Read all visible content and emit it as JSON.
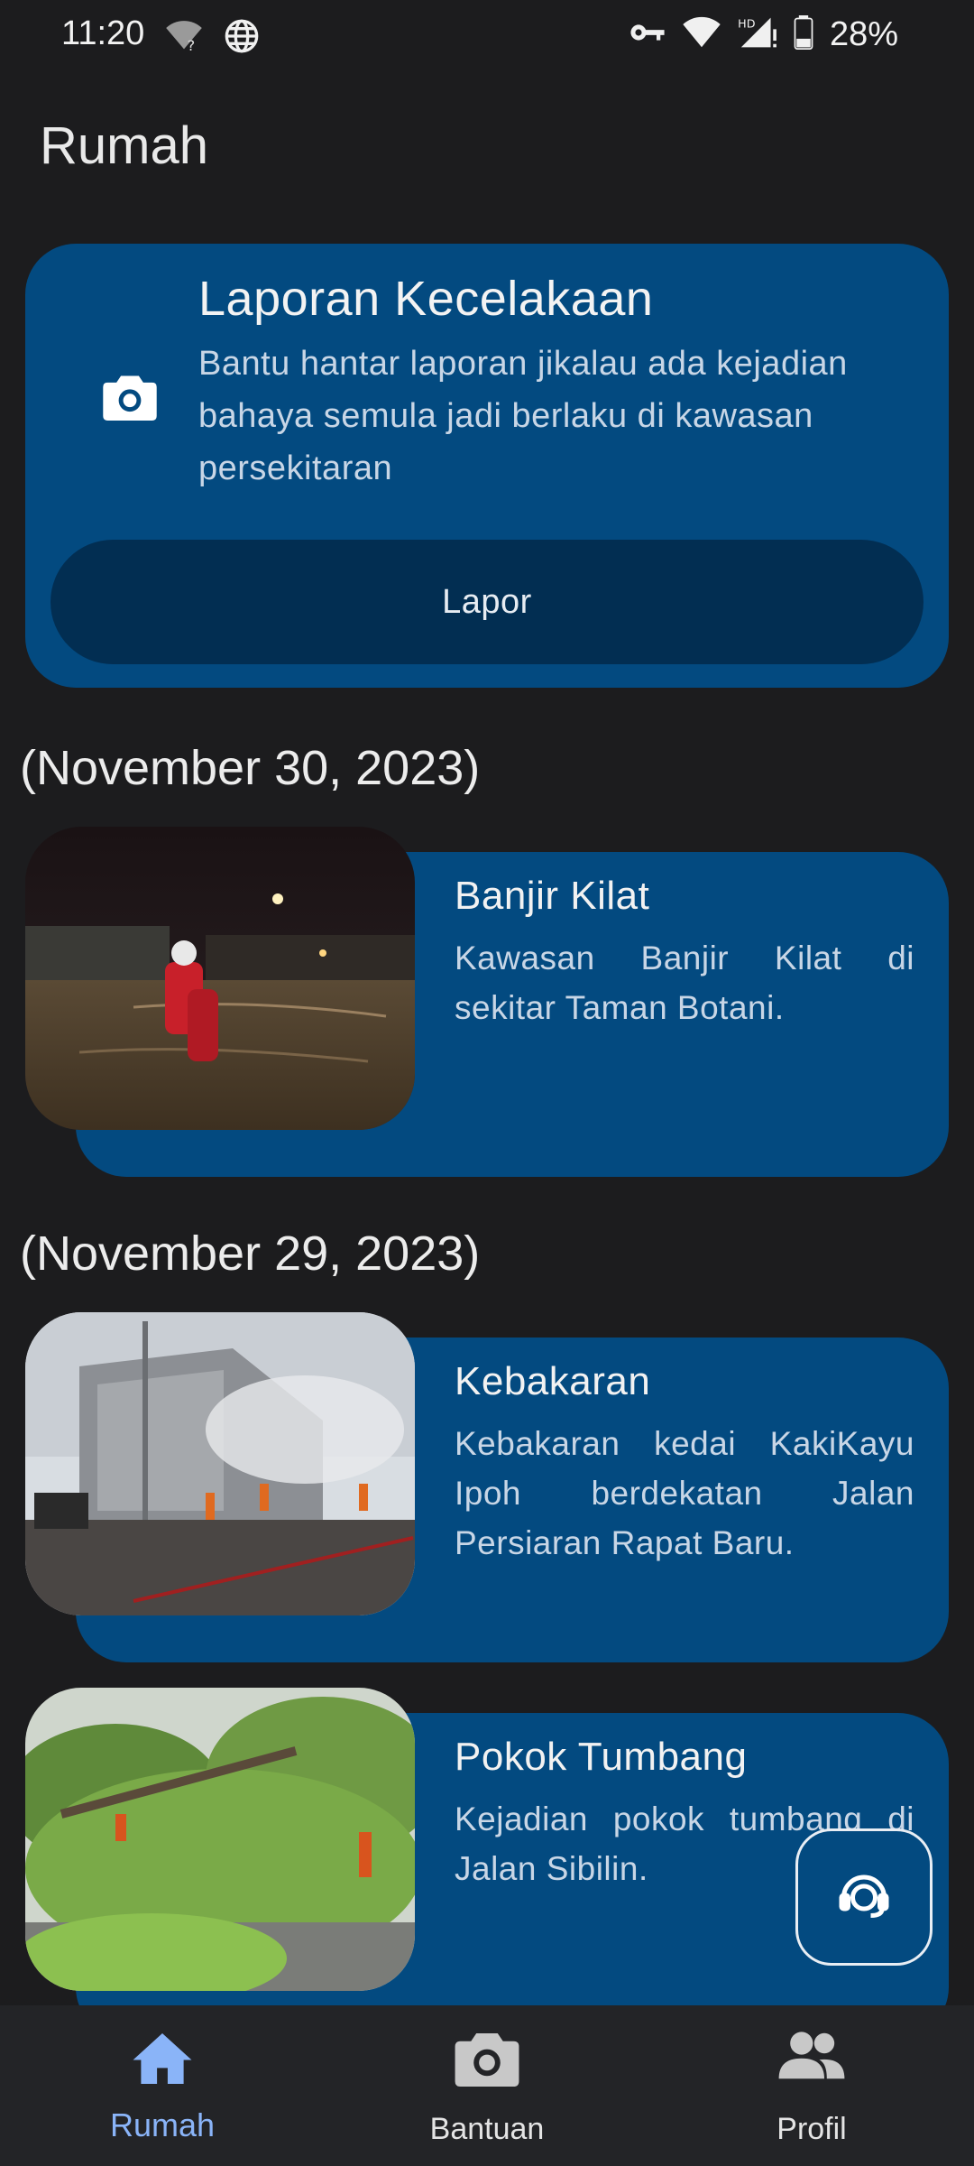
{
  "status_bar": {
    "time": "11:20",
    "battery": "28%",
    "icons": [
      "wifi-question-icon",
      "globe-icon",
      "vpn-key-icon",
      "wifi-icon",
      "signal-hd-icon",
      "battery-icon"
    ]
  },
  "page": {
    "title": "Rumah"
  },
  "report_card": {
    "title": "Laporan Kecelakaan",
    "description": "Bantu hantar laporan jikalau ada kejadian bahaya semula jadi berlaku di kawasan persekitaran",
    "button_label": "Lapor",
    "icon": "camera-icon"
  },
  "feed": {
    "groups": [
      {
        "date": "(November 30, 2023)",
        "items": [
          {
            "title": "Banjir Kilat",
            "description": "Kawasan Banjir Kilat di sekitar Taman Botani."
          }
        ]
      },
      {
        "date": "(November 29, 2023)",
        "items": [
          {
            "title": "Kebakaran",
            "description": "Kebakaran kedai KakiKayu Ipoh berdekatan Jalan Persiaran Rapat Baru."
          },
          {
            "title": "Pokok Tumbang",
            "description": "Kejadian pokok tumbang di Jalan Sibilin."
          }
        ]
      }
    ]
  },
  "fab": {
    "icon": "support-agent-icon"
  },
  "bottom_nav": {
    "items": [
      {
        "label": "Rumah",
        "icon": "home-icon",
        "active": true
      },
      {
        "label": "Bantuan",
        "icon": "camera-icon",
        "active": false
      },
      {
        "label": "Profil",
        "icon": "people-icon",
        "active": false
      }
    ]
  },
  "colors": {
    "background": "#1c1c1e",
    "card": "#034a80",
    "button": "#022e52",
    "accent": "#8ab4f8"
  }
}
